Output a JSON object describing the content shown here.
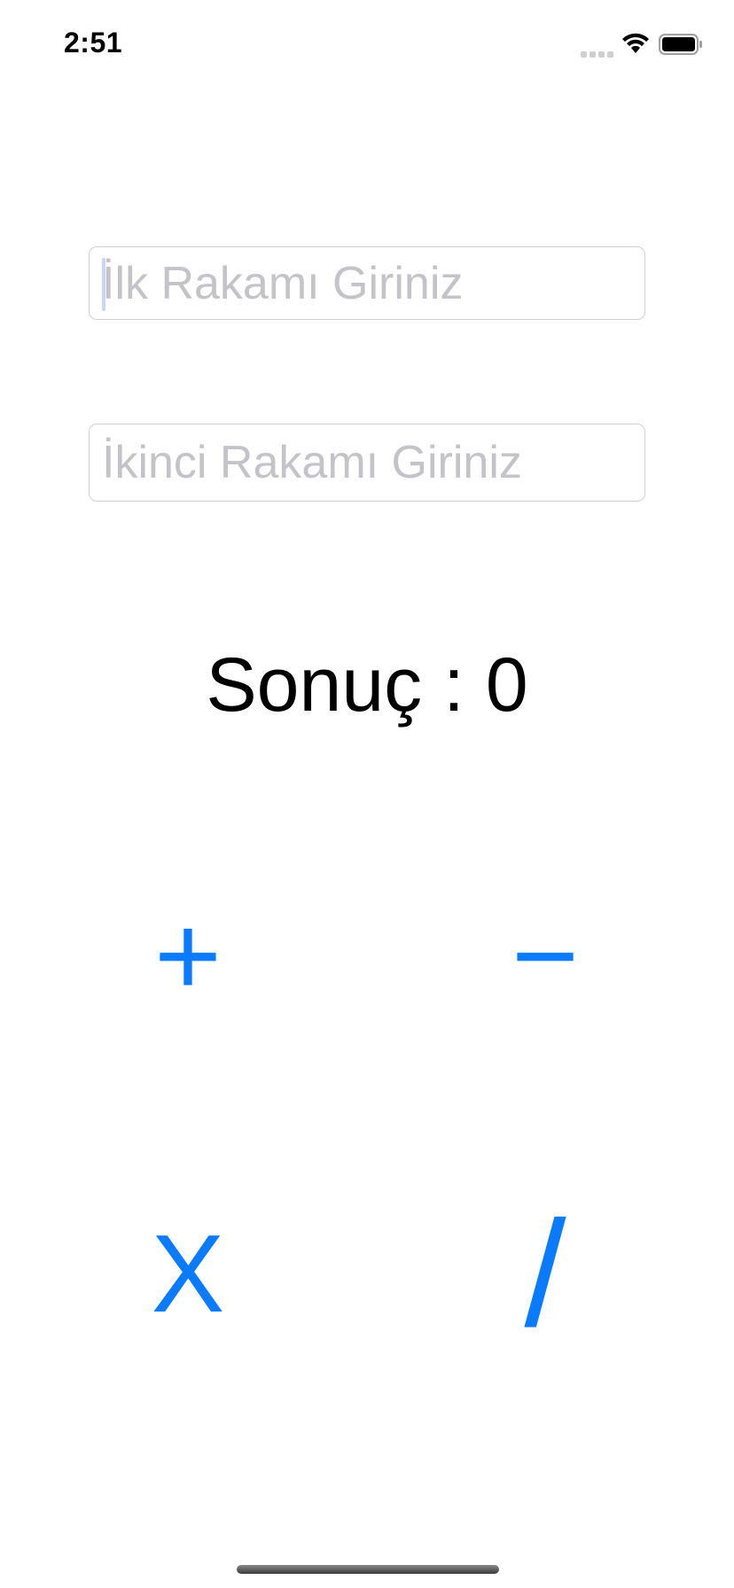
{
  "status_bar": {
    "time": "2:51",
    "signal_icon": "cellular-signal-icon",
    "wifi_icon": "wifi-icon",
    "battery_icon": "battery-icon"
  },
  "form": {
    "first_number": {
      "placeholder": "İlk Rakamı Giriniz",
      "value": ""
    },
    "second_number": {
      "placeholder": "İkinci Rakamı Giriniz",
      "value": ""
    }
  },
  "result": {
    "text": "Sonuç : 0"
  },
  "operations": {
    "add": "+",
    "subtract": "−",
    "multiply": "X",
    "divide": "/"
  },
  "colors": {
    "accent": "#0a7aff",
    "placeholder": "#c4c4c8",
    "field_border": "#d0d0d0",
    "text": "#000000"
  }
}
